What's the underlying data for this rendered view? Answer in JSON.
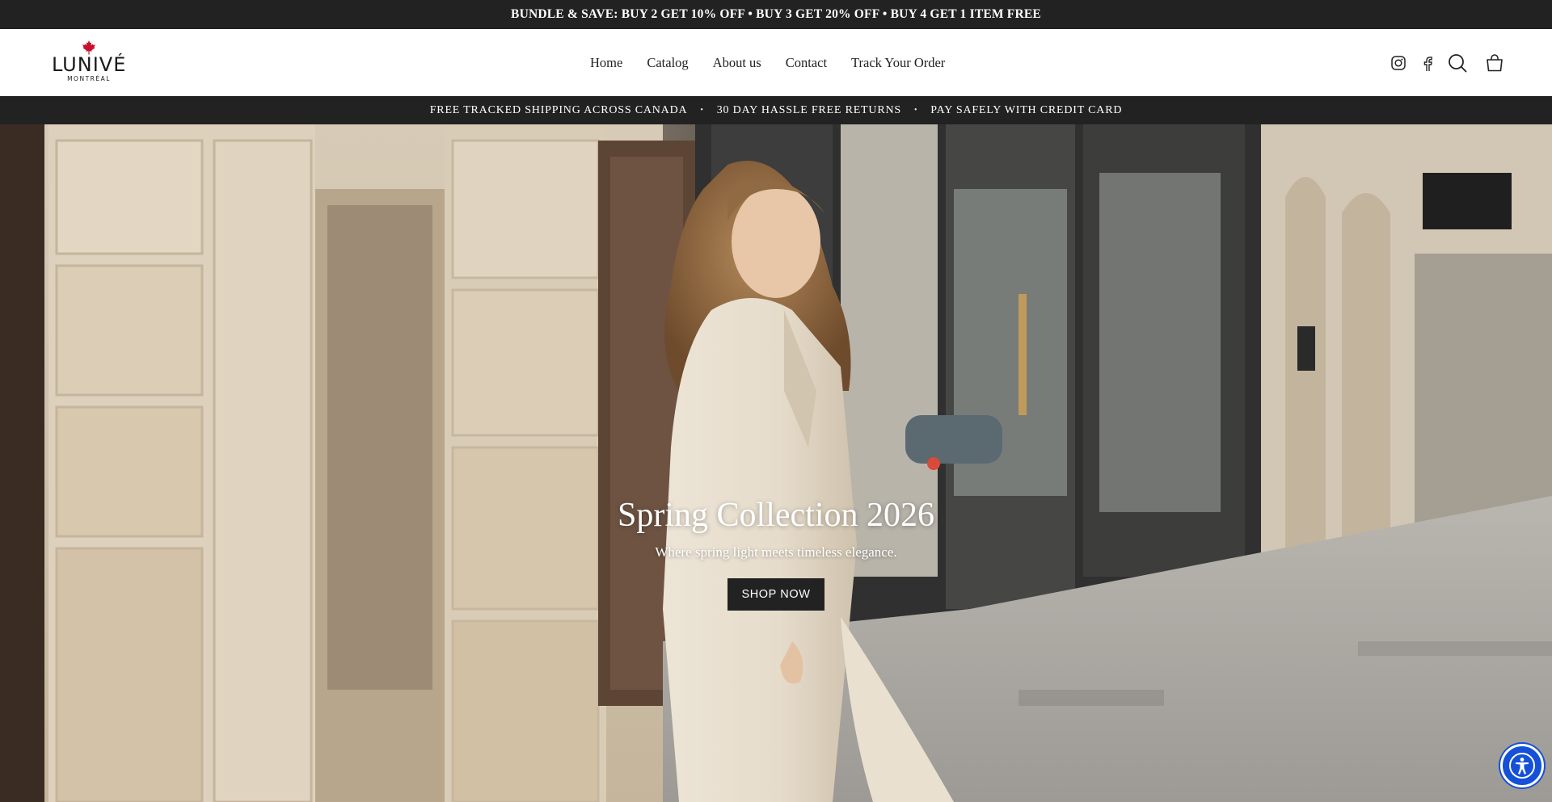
{
  "announcement": {
    "text": "BUNDLE & SAVE: BUY 2 GET 10% OFF • BUY 3 GET 20% OFF • BUY 4 GET 1 ITEM FREE"
  },
  "header": {
    "logo": {
      "brand": "LUNIVÉ",
      "city": "MONTRÉAL"
    },
    "nav": [
      {
        "label": "Home"
      },
      {
        "label": "Catalog"
      },
      {
        "label": "About us"
      },
      {
        "label": "Contact"
      },
      {
        "label": "Track Your Order"
      }
    ],
    "icons": [
      "instagram-icon",
      "facebook-icon",
      "search-icon",
      "cart-icon"
    ]
  },
  "usp_bar": {
    "items": [
      "FREE TRACKED SHIPPING ACROSS CANADA",
      "30 DAY HASSLE FREE RETURNS",
      "PAY SAFELY WITH CREDIT CARD"
    ],
    "separator": "•"
  },
  "hero": {
    "title": "Spring Collection 2026",
    "subtitle": "Where spring light meets timeless elegance.",
    "button_label": "SHOP NOW"
  },
  "accessibility_widget": {
    "icon": "accessibility-icon"
  },
  "colors": {
    "bar_background": "#222222",
    "bar_text": "#ffffff",
    "accessibility_blue": "#1550d8",
    "logo_leaf_red": "#c8102e"
  }
}
